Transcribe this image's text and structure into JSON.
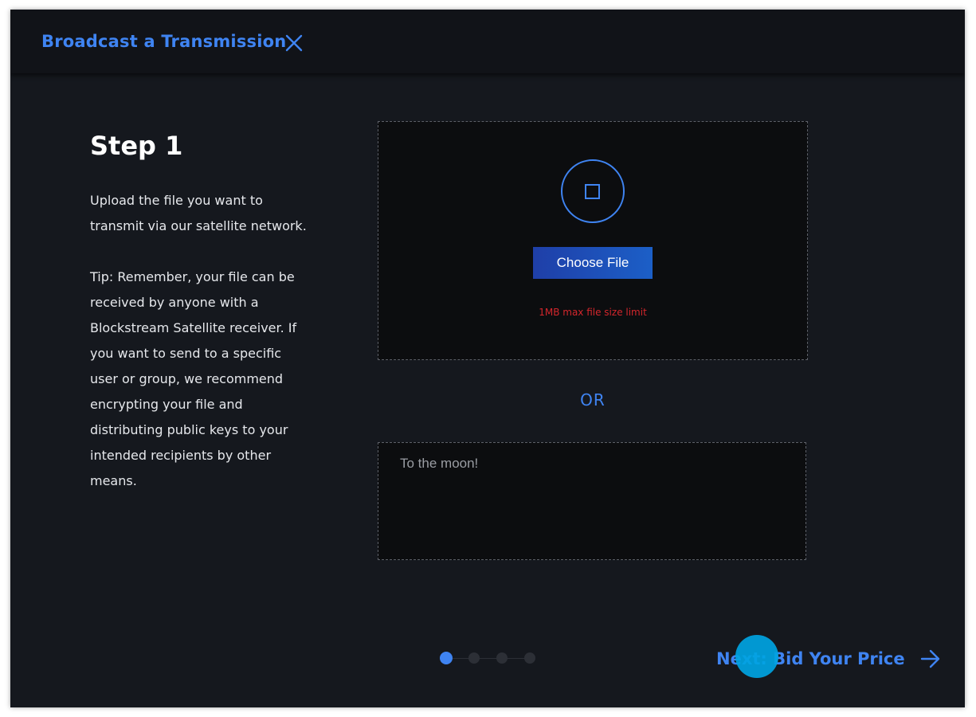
{
  "header": {
    "title": "Broadcast a Transmission",
    "close_icon": "close-icon"
  },
  "step": {
    "title": "Step 1",
    "description": "Upload the file you want to transmit via our satellite network.",
    "tip": "Tip: Remember, your file can be received by anyone with a Blockstream Satellite receiver. If you want to send to a specific user or group, we recommend encrypting your file and distributing public keys to your intended recipients by other means."
  },
  "upload": {
    "icon": "upload-square-icon",
    "choose_file_label": "Choose File",
    "size_limit": "1MB max file size limit"
  },
  "or_label": "OR",
  "message": {
    "placeholder": "To the moon!",
    "value": ""
  },
  "progress": {
    "current_step": 1,
    "total_steps": 4
  },
  "footer": {
    "next_label": "Next: Bid Your Price",
    "next_icon": "arrow-right-icon"
  },
  "colors": {
    "accent": "#3f84f2",
    "background": "#15181e",
    "error": "#d4262c",
    "button_gradient_start": "#1f3fa8",
    "button_gradient_end": "#1c5fc7",
    "click_indicator": "#00a4e2"
  }
}
